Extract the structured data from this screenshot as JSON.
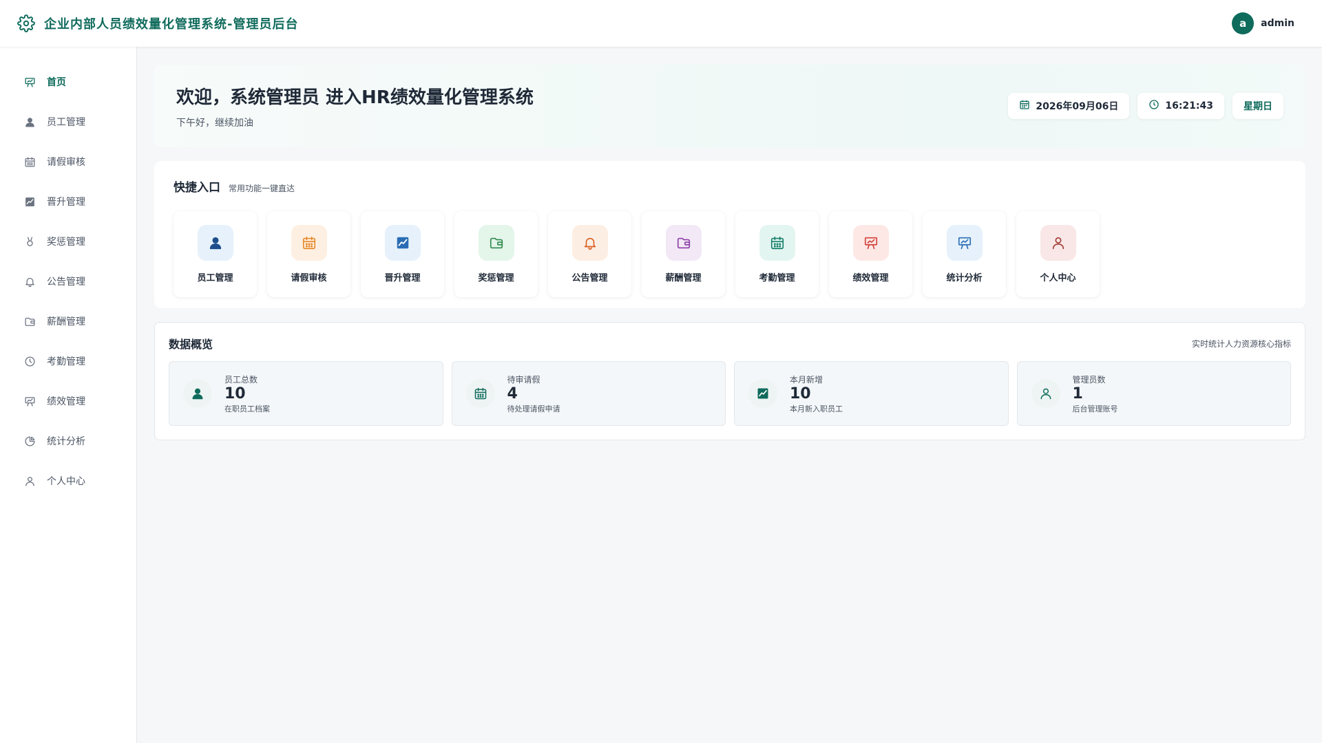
{
  "header": {
    "title": "企业内部人员绩效量化管理系统-管理员后台",
    "avatar_letter": "a",
    "username": "admin",
    "logo_icon": "gear-icon"
  },
  "sidebar": {
    "items": [
      {
        "label": "首页",
        "icon": "presentation-icon",
        "active": true
      },
      {
        "label": "员工管理",
        "icon": "user-icon"
      },
      {
        "label": "请假审核",
        "icon": "calendar-icon"
      },
      {
        "label": "晋升管理",
        "icon": "trend-chart-icon"
      },
      {
        "label": "奖惩管理",
        "icon": "medal-icon"
      },
      {
        "label": "公告管理",
        "icon": "bell-icon"
      },
      {
        "label": "薪酬管理",
        "icon": "wallet-icon"
      },
      {
        "label": "考勤管理",
        "icon": "clock-icon"
      },
      {
        "label": "绩效管理",
        "icon": "presentation-icon"
      },
      {
        "label": "统计分析",
        "icon": "pie-chart-icon"
      },
      {
        "label": "个人中心",
        "icon": "user-outline-icon"
      }
    ]
  },
  "welcome": {
    "heading": "欢迎，系统管理员 进入HR绩效量化管理系统",
    "subtext": "下午好，继续加油",
    "date": "2026年09月06日",
    "time": "16:21:43",
    "weekday": "星期日"
  },
  "quick": {
    "title": "快捷入口",
    "subtitle": "常用功能一键直达",
    "tiles": [
      {
        "label": "员工管理",
        "icon": "user-icon",
        "bg": "#e6f1fb",
        "fg": "#1e4f8a"
      },
      {
        "label": "请假审核",
        "icon": "calendar-icon",
        "bg": "#fdf0e2",
        "fg": "#e8892b"
      },
      {
        "label": "晋升管理",
        "icon": "trend-chart-icon",
        "bg": "#e6f1fb",
        "fg": "#2a6db5"
      },
      {
        "label": "奖惩管理",
        "icon": "wallet-icon",
        "bg": "#e4f5ea",
        "fg": "#2e8a4f"
      },
      {
        "label": "公告管理",
        "icon": "bell-icon",
        "bg": "#fdeee4",
        "fg": "#d9601e"
      },
      {
        "label": "薪酬管理",
        "icon": "wallet-icon",
        "bg": "#f2e8f6",
        "fg": "#8c3fa8"
      },
      {
        "label": "考勤管理",
        "icon": "calendar-icon",
        "bg": "#e3f5f0",
        "fg": "#16806b"
      },
      {
        "label": "绩效管理",
        "icon": "presentation-icon",
        "bg": "#fde8e6",
        "fg": "#d2413a"
      },
      {
        "label": "统计分析",
        "icon": "presentation-icon",
        "bg": "#e6f1fb",
        "fg": "#2a6db5"
      },
      {
        "label": "个人中心",
        "icon": "user-outline-icon",
        "bg": "#f8e7e6",
        "fg": "#a33b35"
      }
    ]
  },
  "overview": {
    "title": "数据概览",
    "subtitle": "实时统计人力资源核心指标",
    "stats": [
      {
        "label": "员工总数",
        "value": "10",
        "desc": "在职员工档案",
        "icon": "user-icon"
      },
      {
        "label": "待审请假",
        "value": "4",
        "desc": "待处理请假申请",
        "icon": "calendar-icon"
      },
      {
        "label": "本月新增",
        "value": "10",
        "desc": "本月新入职员工",
        "icon": "trend-chart-icon"
      },
      {
        "label": "管理员数",
        "value": "1",
        "desc": "后台管理账号",
        "icon": "user-outline-icon"
      }
    ]
  },
  "colors": {
    "brand": "#0f6b5c",
    "text": "#1f2937",
    "muted": "#4b5563",
    "sidebar_icon": "#6b7280"
  }
}
